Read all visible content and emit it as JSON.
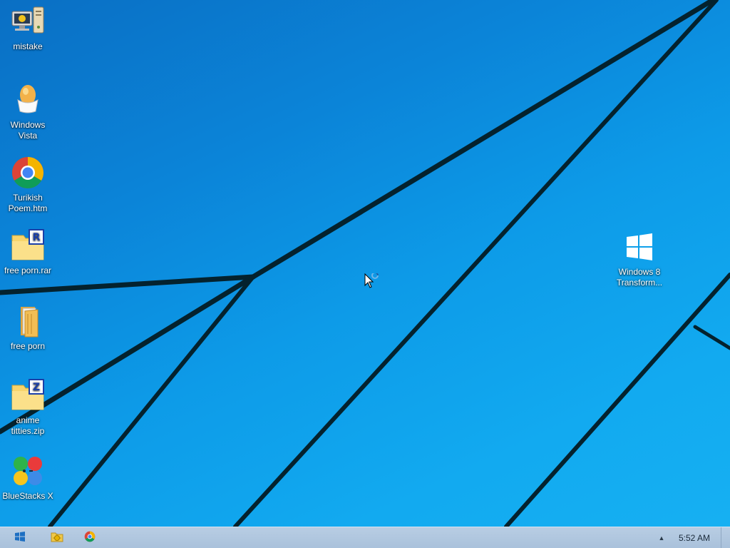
{
  "desktop": {
    "icons": [
      {
        "label": "mistake",
        "icon": "computer-icon"
      },
      {
        "label": "Windows Vista",
        "icon": "egg-cup-icon"
      },
      {
        "label": "Turikish Poem.htm",
        "icon": "chrome-icon"
      },
      {
        "label": "free porn.rar",
        "icon": "rar-archive-icon"
      },
      {
        "label": "free porn",
        "icon": "folder-icon"
      },
      {
        "label": "anime titties.zip",
        "icon": "zip-archive-icon"
      },
      {
        "label": "BlueStacks X",
        "icon": "bluestacks-icon"
      },
      {
        "label": "Windows 8 Transform...",
        "icon": "windows-logo-icon"
      }
    ]
  },
  "taskbar": {
    "start_icon": "windows-start-icon",
    "pinned": [
      {
        "icon": "file-explorer-icon"
      },
      {
        "icon": "chrome-icon"
      }
    ],
    "tray_arrow": "▲",
    "clock": "5:52 AM"
  },
  "colors": {
    "wallpaper_dark": "#0a6fc4",
    "wallpaper_light": "#16b0f2",
    "taskbar": "#b0c7df"
  }
}
